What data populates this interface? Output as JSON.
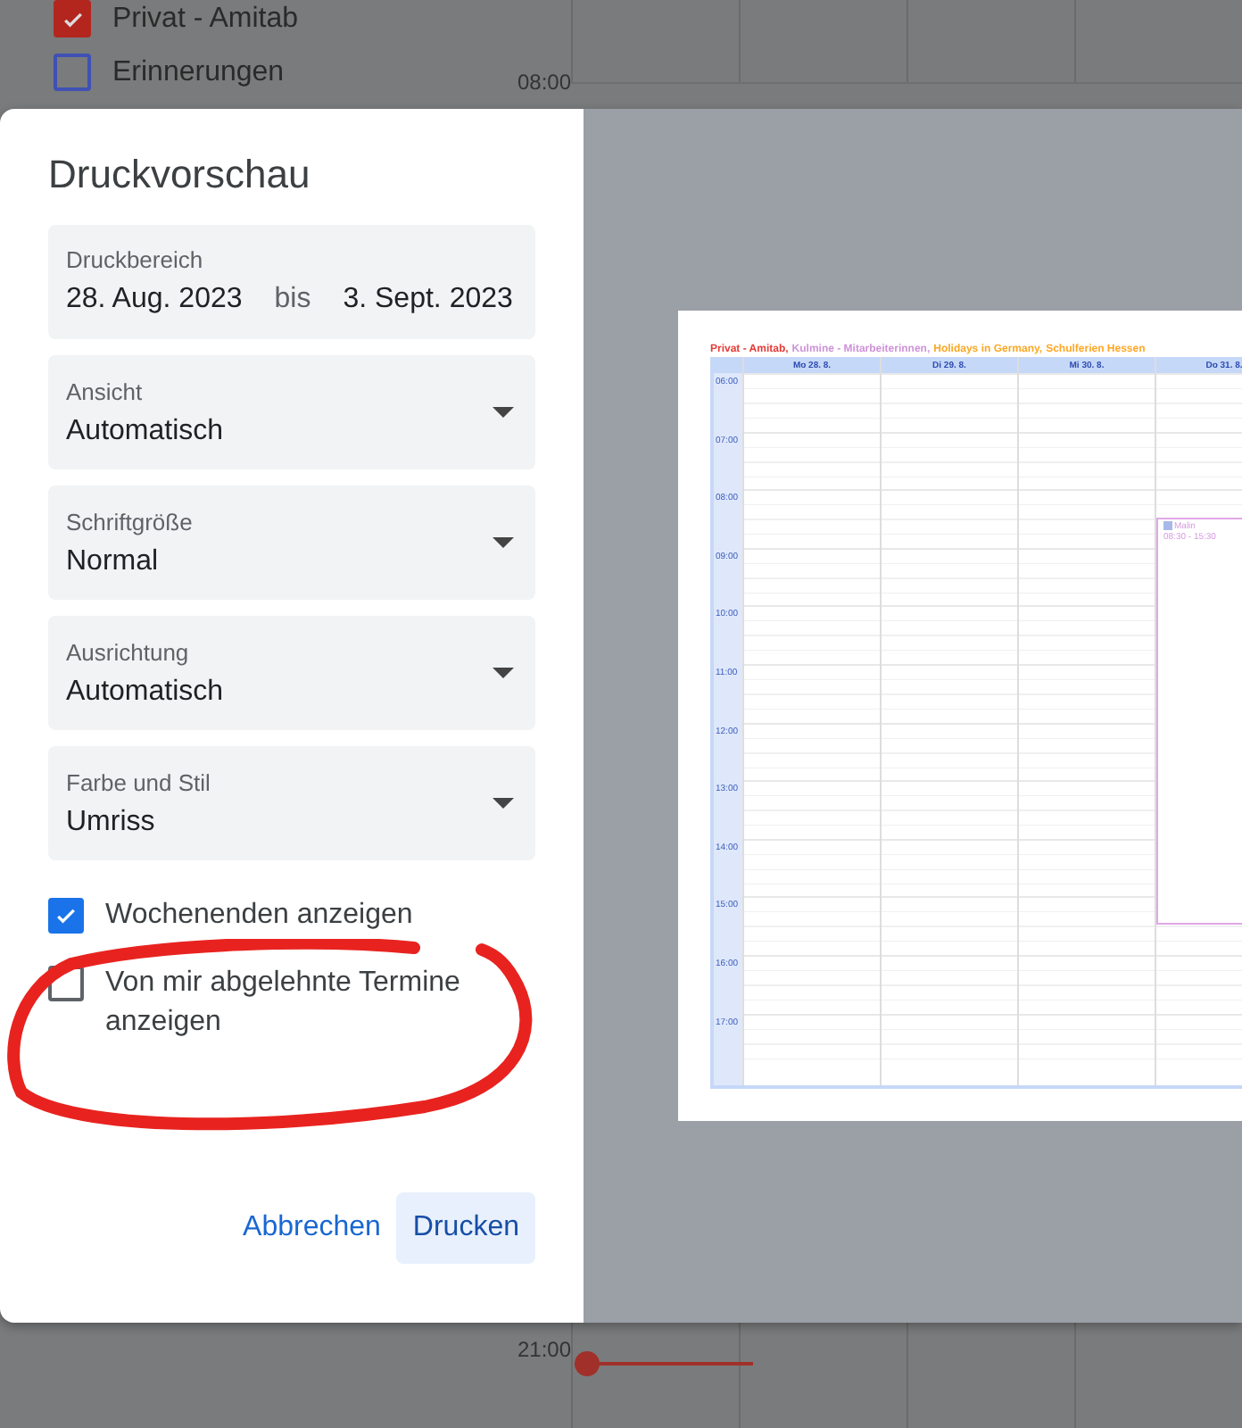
{
  "background": {
    "calendars": [
      {
        "label": "Privat - Amitab",
        "checked": true,
        "color": "#b3261e"
      },
      {
        "label": "Erinnerungen",
        "checked": false,
        "color": "#3f51b5"
      }
    ],
    "times": [
      "08:00",
      "21:00"
    ]
  },
  "dialog": {
    "title": "Druckvorschau",
    "print_range": {
      "label": "Druckbereich",
      "from": "28. Aug. 2023",
      "separator": "bis",
      "to": "3. Sept. 2023"
    },
    "selects": [
      {
        "label": "Ansicht",
        "value": "Automatisch"
      },
      {
        "label": "Schriftgröße",
        "value": "Normal"
      },
      {
        "label": "Ausrichtung",
        "value": "Automatisch"
      },
      {
        "label": "Farbe und Stil",
        "value": "Umriss"
      }
    ],
    "options": [
      {
        "label": "Wochenenden anzeigen",
        "checked": true
      },
      {
        "label": "Von mir abgelehnte Termine anzeigen",
        "checked": false
      }
    ],
    "buttons": [
      {
        "label": "Abbrechen",
        "kind": "text"
      },
      {
        "label": "Drucken",
        "kind": "tonal"
      }
    ]
  },
  "preview": {
    "legend": [
      {
        "label": "Privat - Amitab,",
        "color": "#e53935"
      },
      {
        "label": "Kulmine - Mitarbeiterinnen,",
        "color": "#ce93d8"
      },
      {
        "label": "Holidays in Germany,",
        "color": "#f9a825"
      },
      {
        "label": "Schulferien Hessen",
        "color": "#ffa726"
      }
    ],
    "days": [
      {
        "label": "Mo 28. 8."
      },
      {
        "label": "Di 29. 8."
      },
      {
        "label": "Mi 30. 8."
      },
      {
        "label": "Do 31. 8.",
        "events": [
          {
            "title": "Malin",
            "time": "08:30 - 15:30"
          }
        ]
      }
    ],
    "hours": [
      "06:00",
      "07:00",
      "08:00",
      "09:00",
      "10:00",
      "11:00",
      "12:00",
      "13:00",
      "14:00",
      "15:00",
      "16:00",
      "17:00"
    ]
  }
}
